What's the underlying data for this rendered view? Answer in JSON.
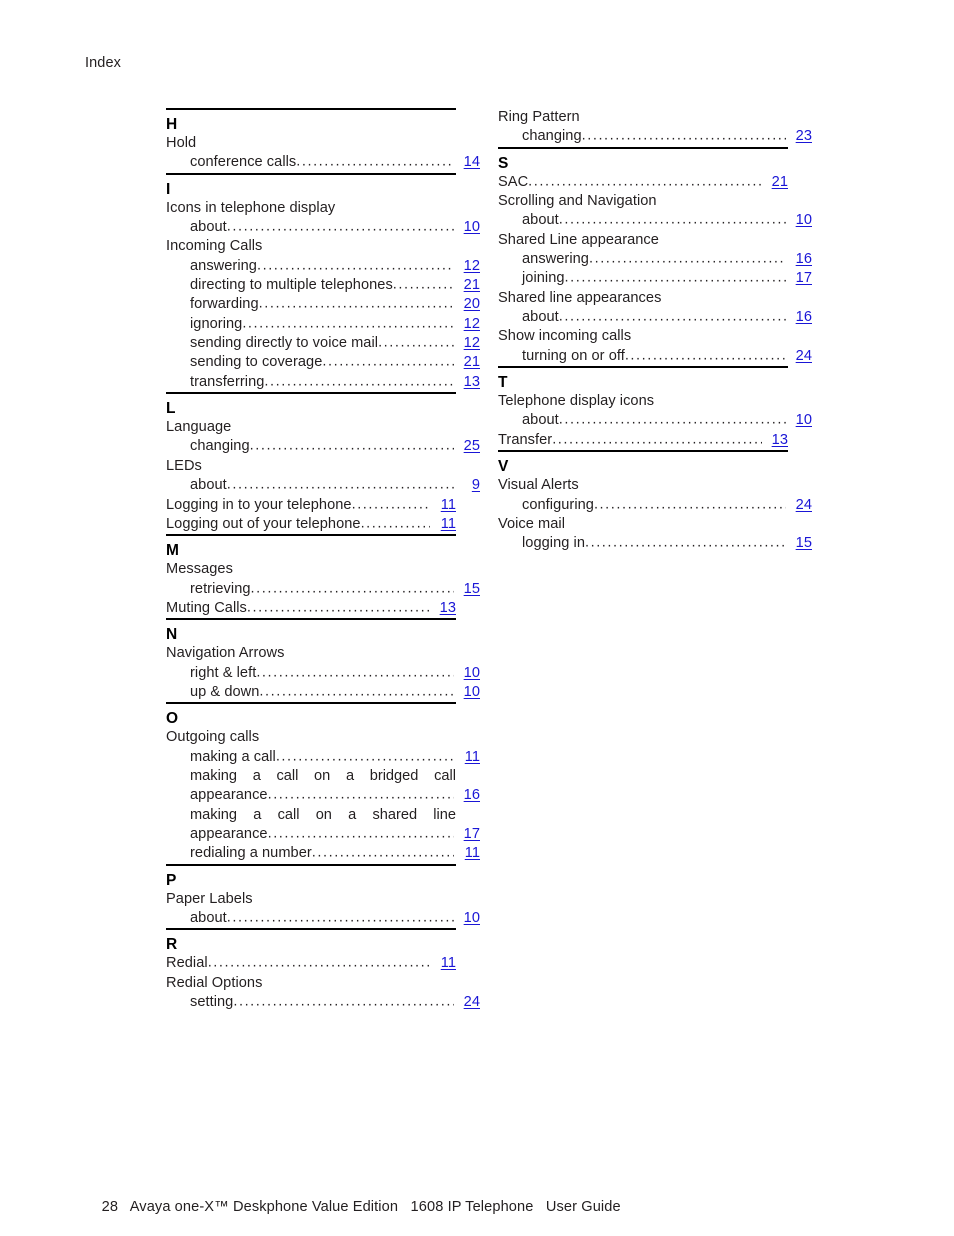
{
  "running_head": "Index",
  "link_color": "#1a16d6",
  "text_color": "#231f20",
  "footer": {
    "page_number": "28",
    "text": "Avaya one-X™ Deskphone Value Edition   1608 IP Telephone   User Guide"
  },
  "leader_dots": "....................................................................................................",
  "columns": {
    "left": {
      "sections": [
        {
          "letter": "H",
          "entries": [
            {
              "level": 1,
              "text": "Hold",
              "page": ""
            },
            {
              "level": 2,
              "text": "conference calls",
              "page": "14"
            }
          ]
        },
        {
          "letter": "I",
          "entries": [
            {
              "level": 1,
              "text": "Icons in telephone display",
              "page": ""
            },
            {
              "level": 2,
              "text": "about",
              "page": "10"
            },
            {
              "level": 1,
              "text": "Incoming Calls",
              "page": ""
            },
            {
              "level": 2,
              "text": "answering",
              "page": "12"
            },
            {
              "level": 2,
              "text": "directing to multiple telephones",
              "page": "21"
            },
            {
              "level": 2,
              "text": "forwarding",
              "page": "20"
            },
            {
              "level": 2,
              "text": "ignoring",
              "page": "12"
            },
            {
              "level": 2,
              "text": "sending directly to voice mail",
              "page": "12"
            },
            {
              "level": 2,
              "text": "sending to coverage",
              "page": "21"
            },
            {
              "level": 2,
              "text": "transferring",
              "page": "13"
            }
          ]
        },
        {
          "letter": "L",
          "entries": [
            {
              "level": 1,
              "text": "Language",
              "page": ""
            },
            {
              "level": 2,
              "text": "changing",
              "page": "25"
            },
            {
              "level": 1,
              "text": "LEDs",
              "page": ""
            },
            {
              "level": 2,
              "text": "about",
              "page": "9"
            },
            {
              "level": 1,
              "text": "Logging in to your telephone",
              "page": "11"
            },
            {
              "level": 1,
              "text": "Logging out of your telephone",
              "page": "11"
            }
          ]
        },
        {
          "letter": "M",
          "entries": [
            {
              "level": 1,
              "text": "Messages",
              "page": ""
            },
            {
              "level": 2,
              "text": "retrieving",
              "page": "15"
            },
            {
              "level": 1,
              "text": "Muting Calls",
              "page": "13"
            }
          ]
        },
        {
          "letter": "N",
          "entries": [
            {
              "level": 1,
              "text": "Navigation Arrows",
              "page": ""
            },
            {
              "level": 2,
              "text": "right & left",
              "page": "10"
            },
            {
              "level": 2,
              "text": "up & down",
              "page": "10"
            }
          ]
        },
        {
          "letter": "O",
          "entries": [
            {
              "level": 1,
              "text": "Outgoing calls",
              "page": ""
            },
            {
              "level": 2,
              "text": "making a call",
              "page": "11"
            },
            {
              "level": 2,
              "wrapped": true,
              "words": [
                "making",
                "a",
                "call",
                "on",
                "a",
                "bridged",
                "call"
              ],
              "text": "making a call on a bridged call appearance",
              "cont": "appearance",
              "page": "16"
            },
            {
              "level": 2,
              "wrapped": true,
              "words": [
                "making",
                "a",
                "call",
                "on",
                "a",
                "shared",
                "line"
              ],
              "text": "making a call on a shared line appearance",
              "cont": "appearance",
              "page": "17"
            },
            {
              "level": 2,
              "text": "redialing a number",
              "page": "11"
            }
          ]
        },
        {
          "letter": "P",
          "entries": [
            {
              "level": 1,
              "text": "Paper Labels",
              "page": ""
            },
            {
              "level": 2,
              "text": "about",
              "page": "10"
            }
          ]
        },
        {
          "letter": "R",
          "entries": [
            {
              "level": 1,
              "text": "Redial",
              "page": "11"
            },
            {
              "level": 1,
              "text": "Redial Options",
              "page": ""
            },
            {
              "level": 2,
              "text": "setting",
              "page": "24"
            }
          ]
        }
      ]
    },
    "right": {
      "lead_entries": [
        {
          "level": 1,
          "text": "Ring Pattern",
          "page": ""
        },
        {
          "level": 2,
          "text": "changing",
          "page": "23"
        }
      ],
      "sections": [
        {
          "letter": "S",
          "entries": [
            {
              "level": 1,
              "text": "SAC",
              "page": "21"
            },
            {
              "level": 1,
              "text": "Scrolling and Navigation",
              "page": ""
            },
            {
              "level": 2,
              "text": "about",
              "page": "10"
            },
            {
              "level": 1,
              "text": "Shared Line appearance",
              "page": ""
            },
            {
              "level": 2,
              "text": "answering",
              "page": "16"
            },
            {
              "level": 2,
              "text": "joining",
              "page": "17"
            },
            {
              "level": 1,
              "text": "Shared line appearances",
              "page": ""
            },
            {
              "level": 2,
              "text": "about",
              "page": "16"
            },
            {
              "level": 1,
              "text": "Show incoming calls",
              "page": ""
            },
            {
              "level": 2,
              "text": "turning on or off",
              "page": "24"
            }
          ]
        },
        {
          "letter": "T",
          "entries": [
            {
              "level": 1,
              "text": "Telephone display icons",
              "page": ""
            },
            {
              "level": 2,
              "text": "about",
              "page": "10"
            },
            {
              "level": 1,
              "text": "Transfer",
              "page": "13"
            }
          ]
        },
        {
          "letter": "V",
          "entries": [
            {
              "level": 1,
              "text": "Visual Alerts",
              "page": ""
            },
            {
              "level": 2,
              "text": "configuring",
              "page": "24"
            },
            {
              "level": 1,
              "text": "Voice mail",
              "page": ""
            },
            {
              "level": 2,
              "text": "logging in",
              "page": "15"
            }
          ]
        }
      ]
    }
  }
}
